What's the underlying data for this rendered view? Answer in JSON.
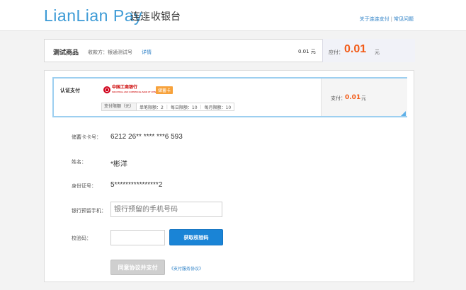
{
  "header": {
    "brand": "LianLian Pay",
    "brand_cn": "连连",
    "subtitle": "收银台",
    "links": [
      "关于连连支付",
      "常见问题"
    ],
    "link_separator": "|"
  },
  "order": {
    "product_name": "测试商品",
    "merchant": "收款方：银通测试号",
    "detail_link": "详情",
    "amount": "0.01 元",
    "due_label": "应付：",
    "due_value": "0.01",
    "due_unit": "元"
  },
  "bank_card": {
    "auth_label": "认证支付",
    "bank_name": "中国工商银行",
    "bank_name_en": "INDUSTRIAL AND COMMERCIAL BANK OF CHINA",
    "card_type": "储蓄卡",
    "limits": {
      "header": "支付限额（元）",
      "per_transaction": "单笔限额：2",
      "daily": "每日限额：10",
      "monthly": "每月限额：10",
      "separator": "|"
    },
    "pay_label": "支付：",
    "pay_value": "0.01",
    "pay_unit": "元"
  },
  "form": {
    "card_number_label": "储蓄卡卡号：",
    "card_number": "6212 26** **** ***6 593",
    "name_label": "姓名：",
    "name": "*彬洋",
    "id_label": "身份证号：",
    "id_number": "5****************2",
    "phone_label": "银行预留手机：",
    "phone_placeholder": "银行预留的手机号码",
    "code_label": "校验码：",
    "code_value": "",
    "get_code_button": "获取校验码",
    "agree_button": "同意协议并支付",
    "agreement_link": "《支付服务协议》"
  },
  "colors": {
    "brand_blue": "#3d9bd6",
    "link_blue": "#2a7fc6",
    "amount_orange": "#f25c19",
    "primary_button": "#1a84d6",
    "disabled_button": "#cfcfcf",
    "card_badge": "#f7a23b"
  }
}
